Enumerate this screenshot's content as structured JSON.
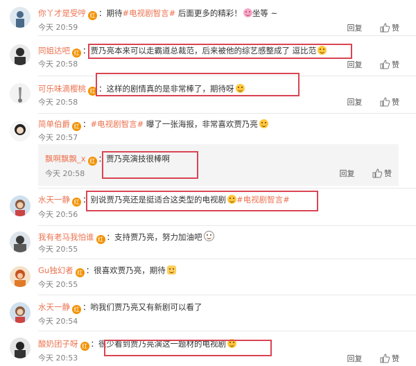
{
  "colors": {
    "username": "#eb7350",
    "topic": "#eb7350",
    "badge": "#f29100",
    "highlight_box": "#d94452",
    "time": "#808080"
  },
  "actions": {
    "reply": "回复",
    "like": "赞",
    "like_icon": "thumbs-up-icon"
  },
  "comments": [
    {
      "user": "你丫才是受哼",
      "badge": "红",
      "colon": "：",
      "text_before": "期待",
      "topic": "#电视剧智言#",
      "text_after": " 后面更多的精彩！",
      "text_after2": "坐等 ~",
      "emoji": "pig-face",
      "time": "今天 20:59"
    },
    {
      "user": "同姐达吧",
      "badge": "红",
      "colon": "：",
      "text": "贾乃亮本来可以走霸道总裁范，后来被他的综艺感整成了 逗比范",
      "emoji": "laughing-face",
      "time": "今天 20:58"
    },
    {
      "user": "可乐味滴樱桃",
      "badge": "红",
      "colon": "：",
      "text": "这样的剧情真的是非常棒了，期待呀",
      "emoji": "blush-face",
      "time": "今天 20:58"
    },
    {
      "user": "简单伯爵",
      "badge": "红",
      "colon": "：",
      "topic": "#电视剧智言#",
      "text": " 曝了一张海报，非常喜欢贾乃亮",
      "emoji": "smile-face",
      "time": "今天 20:57"
    },
    {
      "user": "飘啊飘飘_x",
      "badge": "红",
      "colon": "：",
      "text": "贾乃亮演技很棒啊",
      "time": "今天 20:58"
    },
    {
      "user": "水天一静",
      "badge": "红",
      "colon": "：",
      "text": "别说贾乃亮还是挺适合这类型的电视剧",
      "topic": "#电视剧智言#",
      "emoji": "grin-face",
      "time": "今天 20:56"
    },
    {
      "user": "我有老马我怕谁",
      "badge": "红",
      "colon": "：",
      "text": "支持贾乃亮，努力加油吧",
      "emoji": "smile-outline",
      "time": "今天 20:55"
    },
    {
      "user": "Gu独幻者",
      "badge": "红",
      "colon": "：",
      "text": "很喜欢贾乃亮，期待",
      "emoji": "thumbs-up",
      "time": "今天 20:55"
    },
    {
      "user": "水天一静",
      "badge": "红",
      "colon": "：",
      "text": "哟我们贾乃亮又有新剧可以看了",
      "time": "今天 20:54"
    },
    {
      "user": "酸奶团子呀",
      "badge": "红",
      "colon": "：",
      "text": "很少看到贾乃亮演这一题材的电视剧",
      "emoji": "laughing-face",
      "time": "今天 20:53"
    }
  ]
}
